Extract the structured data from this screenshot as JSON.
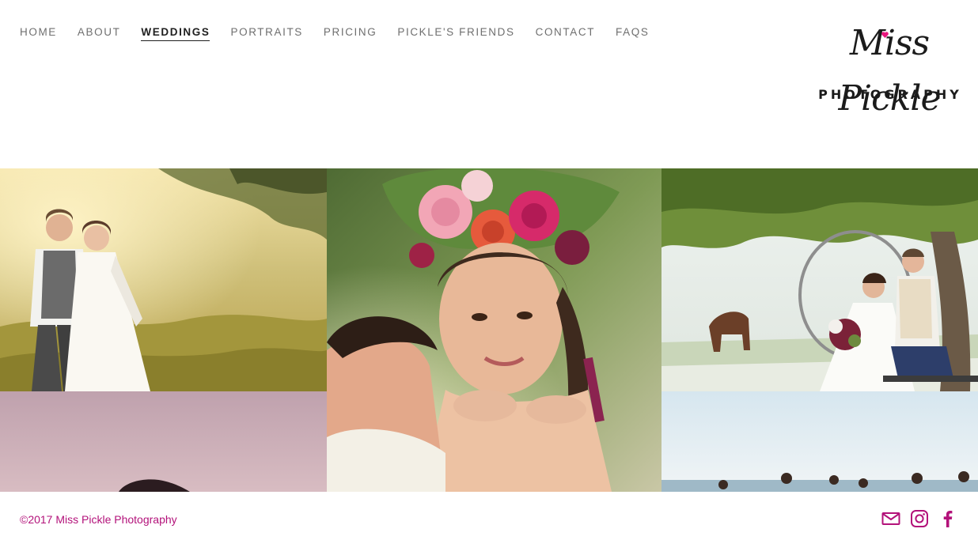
{
  "nav": {
    "items": [
      {
        "label": "HOME",
        "active": false
      },
      {
        "label": "ABOUT",
        "active": false
      },
      {
        "label": "WEDDINGS",
        "active": true
      },
      {
        "label": "PORTRAITS",
        "active": false
      },
      {
        "label": "PRICING",
        "active": false
      },
      {
        "label": "PICKLE'S FRIENDS",
        "active": false
      },
      {
        "label": "CONTACT",
        "active": false
      },
      {
        "label": "FAQS",
        "active": false
      }
    ]
  },
  "logo": {
    "script": "Miss Pickle",
    "subtitle": "PHOTOGRAPHY",
    "heart_color": "#e8157d"
  },
  "gallery": {
    "photos": [
      {
        "subject": "couple-in-golden-field"
      },
      {
        "subject": "brides-with-flower-crown"
      },
      {
        "subject": "couple-under-tree-with-horse"
      },
      {
        "subject": "sunset-portrait"
      },
      {
        "subject": "bridal-party-on-beach"
      }
    ]
  },
  "footer": {
    "copyright": "©2017 Miss Pickle Photography",
    "accent_color": "#b3127a",
    "social": [
      {
        "icon": "mail-icon"
      },
      {
        "icon": "instagram-icon"
      },
      {
        "icon": "facebook-icon"
      }
    ]
  }
}
